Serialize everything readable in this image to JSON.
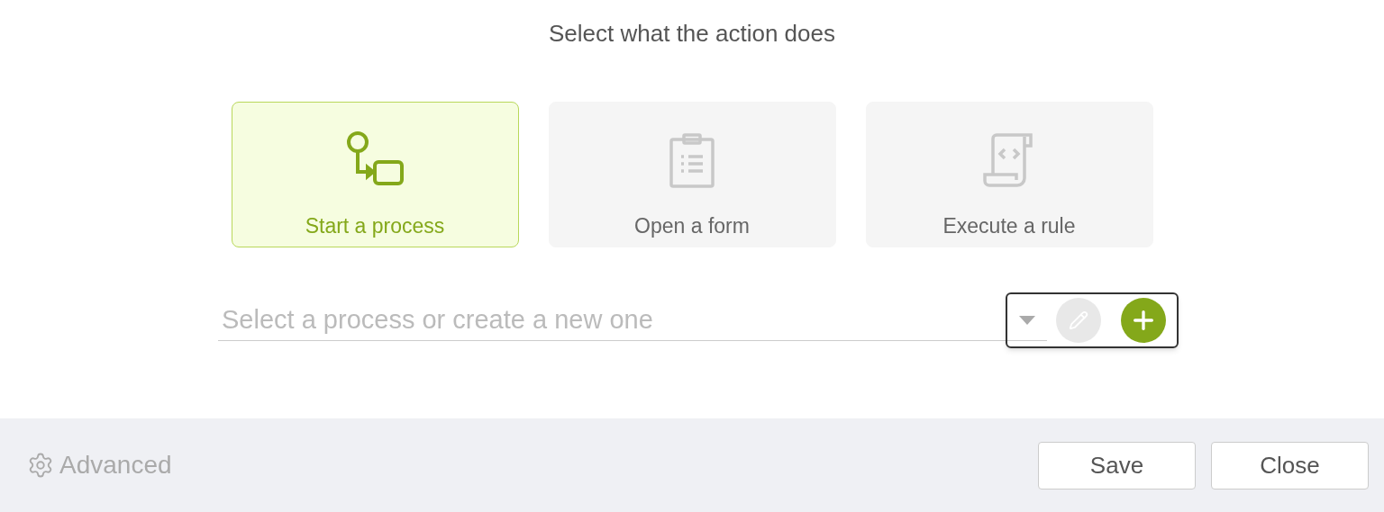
{
  "heading": "Select what the action does",
  "options": [
    {
      "kind": "process",
      "label": "Start a process",
      "selected": true
    },
    {
      "kind": "form",
      "label": "Open a form",
      "selected": false
    },
    {
      "kind": "rule",
      "label": "Execute a rule",
      "selected": false
    }
  ],
  "picker": {
    "placeholder": "Select a process or create a new one",
    "edit_disabled": true
  },
  "footer": {
    "advanced": "Advanced",
    "buttons": [
      "Save",
      "Close"
    ]
  }
}
